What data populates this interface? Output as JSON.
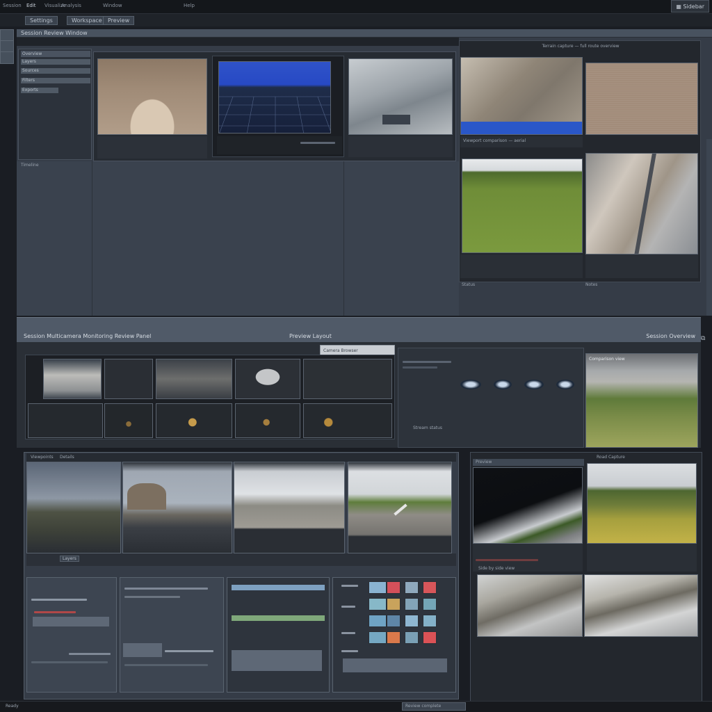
{
  "menubar": {
    "items": [
      "Session",
      "Edit",
      "Visualize",
      "Analysis",
      "Window",
      "Help"
    ],
    "right_label": "Sidebar"
  },
  "toolbar": {
    "tab1": "Settings",
    "tab2": "Workspace",
    "tab3": "Preview"
  },
  "top_section": {
    "title": "Session Review Window",
    "side_items": [
      "Overview",
      "Layers",
      "Sources",
      "Filters",
      "Exports"
    ],
    "lower_label": "Timeline",
    "right_header": "Terrain capture — full route overview",
    "right_caption": "Viewport comparison — aerial",
    "bottom_labels": [
      "Status",
      "Notes"
    ]
  },
  "middle_section": {
    "header_left": "Session Multicamera Monitoring Review Panel",
    "header_mid": "Preview Layout",
    "header_right": "Session Overview",
    "sub_header": "Camera Browser",
    "right_top_label": "Comparison view",
    "strip_caption": "Stream status"
  },
  "bottom_section": {
    "left_header": "Viewpoints",
    "left_tab": "Details",
    "small_tab": "Layers",
    "right_header": "Preview",
    "right_label": "Road Capture",
    "right_caption": "Side by side view"
  },
  "footer": {
    "left_text": "Ready",
    "right_text": "Review complete"
  },
  "colors": {
    "swatches": [
      [
        "#8ab3d1",
        "#d4505a",
        "#8fa9bd",
        "#d7565a"
      ],
      [
        "#87b8c8",
        "#c9a35c",
        "#83a4b8",
        "#74a6b7"
      ],
      [
        "#6fa3c4",
        "#5f86a7",
        "#8fb7d1",
        "#84b1c8"
      ],
      [
        "#75a8c3",
        "#d9794b",
        "#7aa0b5",
        "#db5256"
      ]
    ]
  }
}
